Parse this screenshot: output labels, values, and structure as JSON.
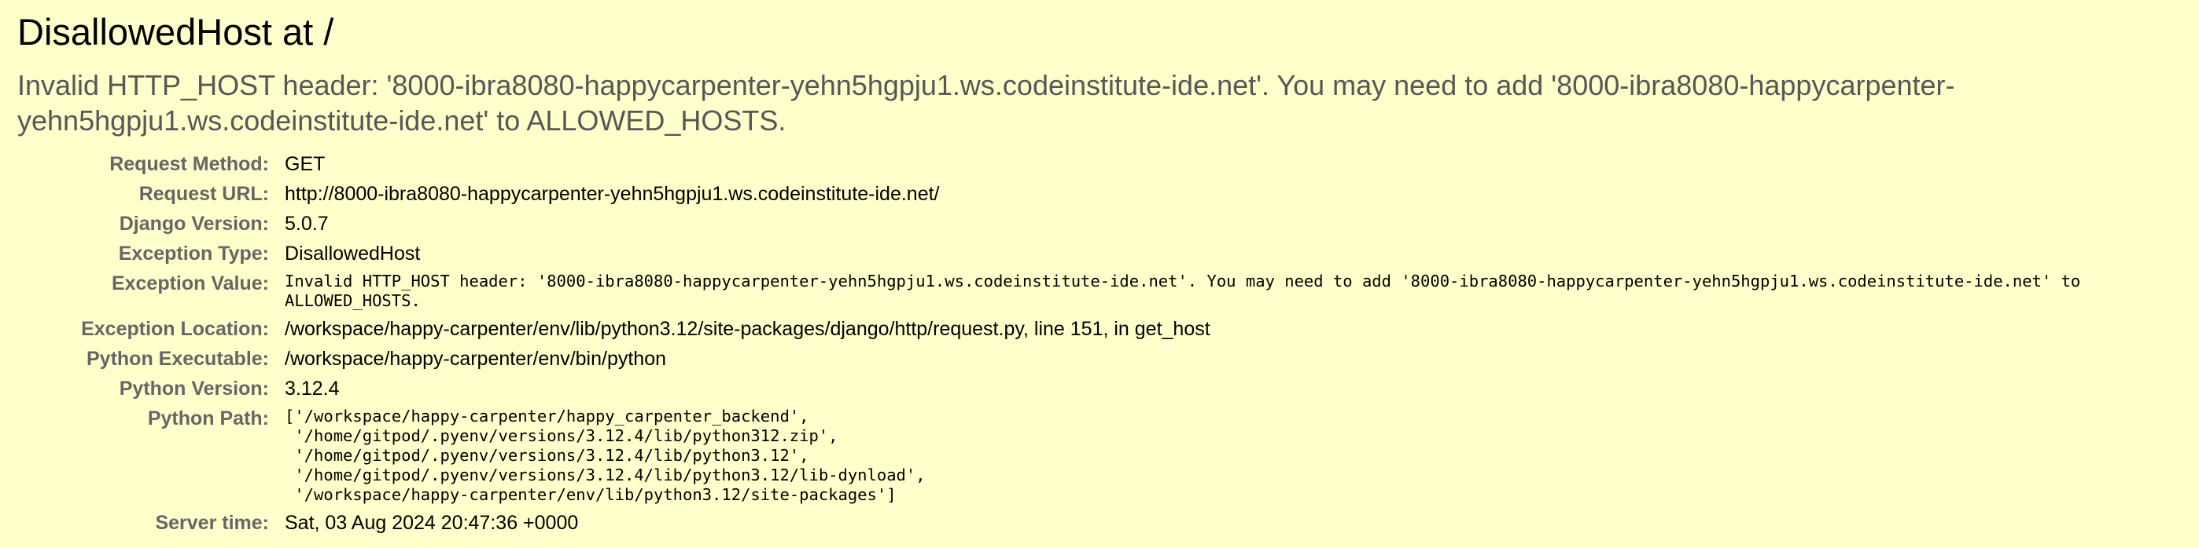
{
  "summary": {
    "title": "DisallowedHost at /",
    "message": "Invalid HTTP_HOST header: '8000-ibra8080-happycarpenter-yehn5hgpju1.ws.codeinstitute-ide.net'. You may need to add '8000-ibra8080-happycarpenter-yehn5hgpju1.ws.codeinstitute-ide.net' to ALLOWED_HOSTS."
  },
  "meta": {
    "request_method": {
      "label": "Request Method:",
      "value": "GET"
    },
    "request_url": {
      "label": "Request URL:",
      "value": "http://8000-ibra8080-happycarpenter-yehn5hgpju1.ws.codeinstitute-ide.net/"
    },
    "django_version": {
      "label": "Django Version:",
      "value": "5.0.7"
    },
    "exception_type": {
      "label": "Exception Type:",
      "value": "DisallowedHost"
    },
    "exception_value": {
      "label": "Exception Value:",
      "value": "Invalid HTTP_HOST header: '8000-ibra8080-happycarpenter-yehn5hgpju1.ws.codeinstitute-ide.net'. You may need to add '8000-ibra8080-happycarpenter-yehn5hgpju1.ws.codeinstitute-ide.net' to ALLOWED_HOSTS."
    },
    "exception_location": {
      "label": "Exception Location:",
      "value": "/workspace/happy-carpenter/env/lib/python3.12/site-packages/django/http/request.py, line 151, in get_host"
    },
    "python_executable": {
      "label": "Python Executable:",
      "value": "/workspace/happy-carpenter/env/bin/python"
    },
    "python_version": {
      "label": "Python Version:",
      "value": "3.12.4"
    },
    "python_path": {
      "label": "Python Path:",
      "value": "['/workspace/happy-carpenter/happy_carpenter_backend',\n '/home/gitpod/.pyenv/versions/3.12.4/lib/python312.zip',\n '/home/gitpod/.pyenv/versions/3.12.4/lib/python3.12',\n '/home/gitpod/.pyenv/versions/3.12.4/lib/python3.12/lib-dynload',\n '/workspace/happy-carpenter/env/lib/python3.12/site-packages']"
    },
    "server_time": {
      "label": "Server time:",
      "value": "Sat, 03 Aug 2024 20:47:36 +0000"
    }
  }
}
